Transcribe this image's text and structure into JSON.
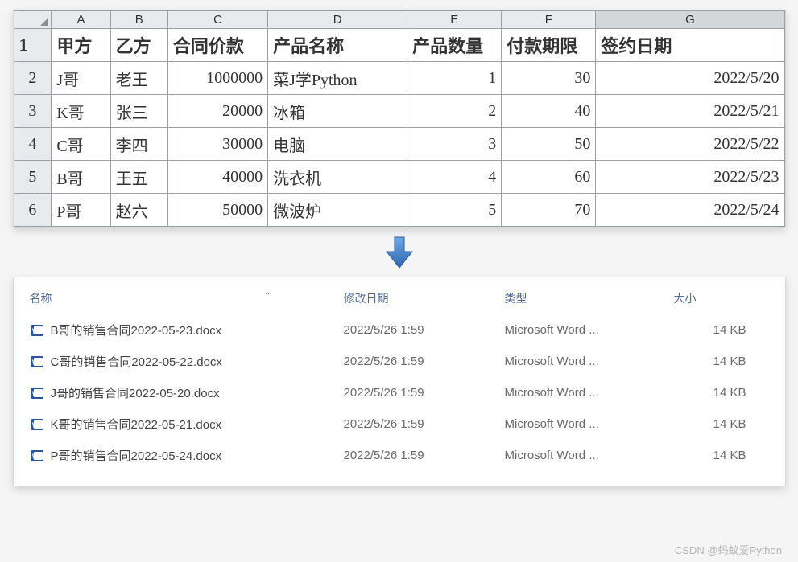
{
  "sheet": {
    "col_letters": [
      "A",
      "B",
      "C",
      "D",
      "E",
      "F",
      "G"
    ],
    "row_numbers": [
      "1",
      "2",
      "3",
      "4",
      "5",
      "6"
    ],
    "headers": {
      "a": "甲方",
      "b": "乙方",
      "c": "合同价款",
      "d": "产品名称",
      "e": "产品数量",
      "f": "付款期限",
      "g": "签约日期"
    },
    "rows": [
      {
        "a": "J哥",
        "b": "老王",
        "c": "1000000",
        "d": "菜J学Python",
        "e": "1",
        "f": "30",
        "g": "2022/5/20"
      },
      {
        "a": "K哥",
        "b": "张三",
        "c": "20000",
        "d": "冰箱",
        "e": "2",
        "f": "40",
        "g": "2022/5/21"
      },
      {
        "a": "C哥",
        "b": "李四",
        "c": "30000",
        "d": "电脑",
        "e": "3",
        "f": "50",
        "g": "2022/5/22"
      },
      {
        "a": "B哥",
        "b": "王五",
        "c": "40000",
        "d": "洗衣机",
        "e": "4",
        "f": "60",
        "g": "2022/5/23"
      },
      {
        "a": "P哥",
        "b": "赵六",
        "c": "50000",
        "d": "微波炉",
        "e": "5",
        "f": "70",
        "g": "2022/5/24"
      }
    ]
  },
  "explorer": {
    "columns": {
      "name": "名称",
      "modified": "修改日期",
      "type": "类型",
      "size": "大小"
    },
    "files": [
      {
        "name": "B哥的销售合同2022-05-23.docx",
        "modified": "2022/5/26 1:59",
        "type": "Microsoft Word ...",
        "size": "14 KB"
      },
      {
        "name": "C哥的销售合同2022-05-22.docx",
        "modified": "2022/5/26 1:59",
        "type": "Microsoft Word ...",
        "size": "14 KB"
      },
      {
        "name": "J哥的销售合同2022-05-20.docx",
        "modified": "2022/5/26 1:59",
        "type": "Microsoft Word ...",
        "size": "14 KB"
      },
      {
        "name": "K哥的销售合同2022-05-21.docx",
        "modified": "2022/5/26 1:59",
        "type": "Microsoft Word ...",
        "size": "14 KB"
      },
      {
        "name": "P哥的销售合同2022-05-24.docx",
        "modified": "2022/5/26 1:59",
        "type": "Microsoft Word ...",
        "size": "14 KB"
      }
    ]
  },
  "watermark": "CSDN @蚂蚁爱Python"
}
